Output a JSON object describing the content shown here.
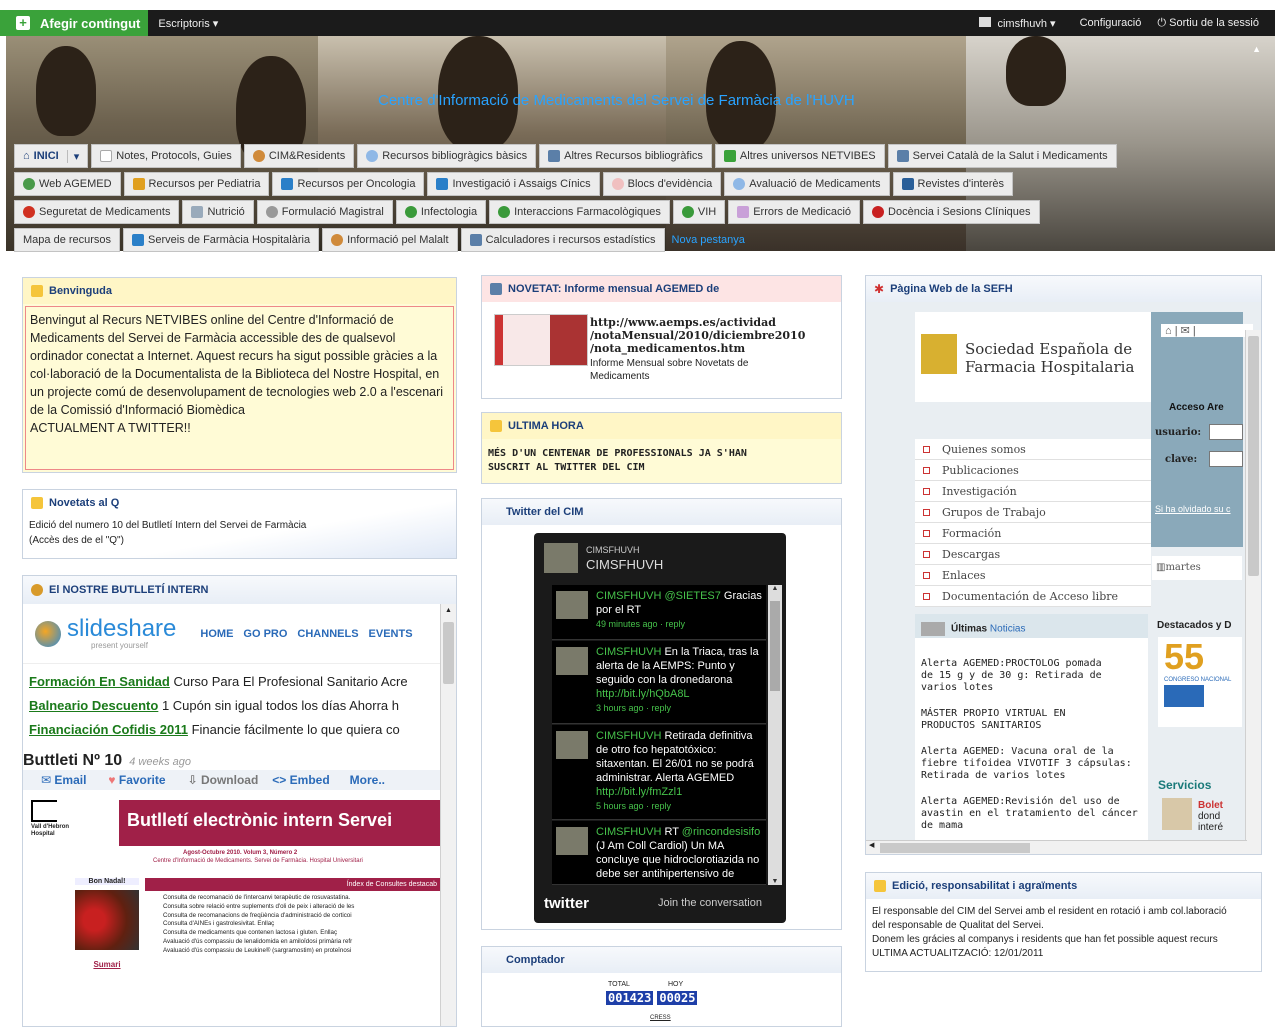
{
  "topbar": {
    "add_label": "Afegir contingut",
    "desktops_label": "Escriptoris ▾",
    "user_label": "cimsfhuvh ▾",
    "config_label": "Configuració",
    "logout_label": "Sortiu de la sessió"
  },
  "banner": {
    "title": "Centre d'Informació de Medicaments del Servei de Farmàcia de l'HUVH"
  },
  "nav": {
    "row1": [
      "INICI",
      "Notes, Protocols, Guies",
      "CIM&Residents",
      "Recursos bibliogràgics bàsics",
      "Altres Recursos bibliogràfics",
      "Altres universos NETVIBES",
      "Servei Català de la Salut i Medicaments"
    ],
    "row2": [
      "Web AGEMED",
      "Recursos per Pediatria",
      "Recursos per Oncologia",
      "Investigació i Assaigs Cínics",
      "Blocs d'evidència",
      "Avaluació de Medicaments",
      "Revistes d'interès"
    ],
    "row3": [
      "Seguretat de Medicaments",
      "Nutrició",
      "Formulació Magistral",
      "Infectologia",
      "Interaccions Farmacològiques",
      "VIH",
      "Errors de Medicació",
      "Docència i Sesions Clíniques"
    ],
    "row4": [
      "Mapa de recursos",
      "Serveis de Farmàcia Hospitalària",
      "Informació pel Malalt",
      "Calculadores i recursos estadístics"
    ],
    "new_tab": "Nova pestanya"
  },
  "benvinguda": {
    "title": "Benvinguda",
    "text": "Benvingut al Recurs NETVIBES online del Centre d'Informació de Medicaments del Servei de Farmàcia accessible des de qualsevol ordinador conectat a Internet. Aquest recurs ha sigut possible gràcies a la col·laboració de la Documentalista de la Biblioteca del Nostre Hospital, en un projecte comú de desenvolupament de tecnologies web 2.0 a l'escenari de la Comissió d'Informació Biomèdica",
    "footer": "ACTUALMENT A TWITTER!!"
  },
  "novetats": {
    "title": "Novetats al Q",
    "line1": "Edició del numero 10 del Butlletí Intern del Servei de Farmàcia",
    "line2": "(Accès des de el \"Q\")"
  },
  "butlleti": {
    "title": "El NOSTRE BUTLLETÍ INTERN",
    "slideshare_logo": "slideshare",
    "slideshare_tag": "present yourself",
    "ss_nav": [
      "HOME",
      "GO PRO",
      "CHANNELS",
      "EVENTS"
    ],
    "ads": [
      {
        "link": "Formación En Sanidad",
        "text": " Curso Para El Profesional Sanitario Acre"
      },
      {
        "link": "Balneario Descuento",
        "text": " 1 Cupón sin igual todos los días Ahorra h"
      },
      {
        "link": "Financiación Cofidis 2011",
        "text": " Financie fácilmente lo que quiera co"
      }
    ],
    "doc_title": "Buttleti Nº 10",
    "doc_age": "4 weeks ago",
    "actions": [
      "Email",
      "Favorite",
      "Download",
      "<> Embed",
      "More.."
    ],
    "slide_heading": "Butlletí electrònic intern Servei",
    "slide_sub": "Agost-Octubre 2010. Volum 3, Número 2",
    "slide_org": "Centre d'Informació de Medicaments. Servei de Farmàcia. Hospital Universitari",
    "slide_section": "Índex de Consultes destacab",
    "slide_side1": "Bon Nadal!",
    "slide_side2": "Sumari",
    "slide_items": [
      "Consulta de recomanació de l'intercanvi terapèutic de rosuvastatina.",
      "Consulta sobre relació entre suplements d'oli de peix i alteració de les",
      "Consulta de recomanacions de freqüència d'administració de corticoi",
      "Consulta d'AINEs i gastrolesivitat. Enllaç",
      "Consulta de medicaments que contenen lactosa i gluten. Enllaç",
      "Avaluació d'ús compassiu de lenalidomida en amiloïdosi primària refr",
      "Avaluació d'ús compassiu de Leukine® (sargramostim) en proteïnosi"
    ]
  },
  "novetat": {
    "title": "NOVETAT: Informe mensual AGEMED de",
    "url": "http://www.aemps.es/actividad/notaMensual/2010/diciembre2010/nota_medicamentos.htm",
    "url1": "http://www.aemps.es/actividad",
    "url2": "/notaMensual/2010/diciembre2010",
    "url3": "/nota_medicamentos.htm",
    "desc1": "Informe Mensual sobre Novetats de",
    "desc2": "Medicaments"
  },
  "ultima": {
    "title": "ULTIMA HORA",
    "text1": "MÉS D'UN CENTENAR DE PROFESSIONALS JA S'HAN",
    "text2": "SUSCRIT AL TWITTER DEL CIM"
  },
  "twitter": {
    "title": "Twitter del CIM",
    "handle_small": "CIMSFHUVH",
    "handle_big": "CIMSFHUVH",
    "logo": "twitter",
    "join": "Join the conversation",
    "tweets": [
      {
        "user": "CIMSFHUVH",
        "pre": " ",
        "mention": "@SIETES7",
        "text": " Gracias por el RT",
        "time": "49 minutes ago · reply"
      },
      {
        "user": "CIMSFHUVH",
        "pre": " ",
        "mention": "",
        "text": "En la Triaca, tras la alerta de la AEMPS: Punto y seguido con la dronedarona ",
        "link": "http://bit.ly/hQbA8L",
        "time": "3 hours ago · reply"
      },
      {
        "user": "CIMSFHUVH",
        "pre": " ",
        "mention": "",
        "text": "Retirada definitiva de otro fco hepatotóxico: sitaxentan. El 26/01 no se podrá administrar. Alerta AGEMED ",
        "link": "http://bit.ly/fmZzl1",
        "time": "5 hours ago · reply"
      },
      {
        "user": "CIMSFHUVH",
        "pre": " RT ",
        "mention": "@rincondesisifo",
        "text": " (J Am Coll Cardiol) Un MA concluye que hidroclorotiazida no debe ser antihipertensivo de",
        "time": ""
      }
    ]
  },
  "comptador": {
    "title": "Comptador",
    "total_label": "TOTAL",
    "hoy_label": "HOY",
    "total": "001423",
    "hoy": "00025",
    "link": "CRESS"
  },
  "sefh": {
    "title": "Pàgina Web de la SEFH",
    "logo_line1": "Sociedad Española de",
    "logo_line2": "Farmacia Hospitalaria",
    "access": "Acceso Are",
    "usuario": "usuario:",
    "clave": "clave:",
    "forgot": "Si ha olvidado su c",
    "menu": [
      "Quienes somos",
      "Publicaciones",
      "Investigación",
      "Grupos de Trabajo",
      "Formación",
      "Descargas",
      "Enlaces",
      "Documentación de Acceso libre"
    ],
    "ultimas": "Últimas",
    "noticias": "Noticias",
    "destacados": "Destacados y D",
    "congreso": "55",
    "congreso_sub": "CONGRESO NACIONAL",
    "servicios": "Servicios",
    "martes": "martes",
    "bolet": "Bolet",
    "dond": "dond",
    "inter": "interé",
    "alerts": [
      [
        "Alerta AGEMED:PROCTOLOG pomada",
        "de 15 g y de 30 g: Retirada de",
        "varios lotes"
      ],
      [
        "MÁSTER PROPIO VIRTUAL EN",
        "PRODUCTOS SANITARIOS"
      ],
      [
        "Alerta AGEMED: Vacuna oral de la",
        "fiebre tifoidea VIVOTIF 3 cápsulas:",
        "Retirada de varios lotes"
      ],
      [
        "Alerta AGEMED:Revisión del uso de",
        "avastin en el tratamiento del cáncer",
        "de mama"
      ]
    ]
  },
  "edicio": {
    "title": "Edició, responsabilitat i agraïments",
    "line1": "El responsable del CIM del Servei amb el resident en rotació i amb col.laboració",
    "line2": "del responsable de Qualitat del Servei.",
    "line3": "Donem les grácies al companys i residents que han fet possible aquest recurs",
    "line4": "ULTIMA ACTUALITZACIÓ: 12/01/2011"
  }
}
